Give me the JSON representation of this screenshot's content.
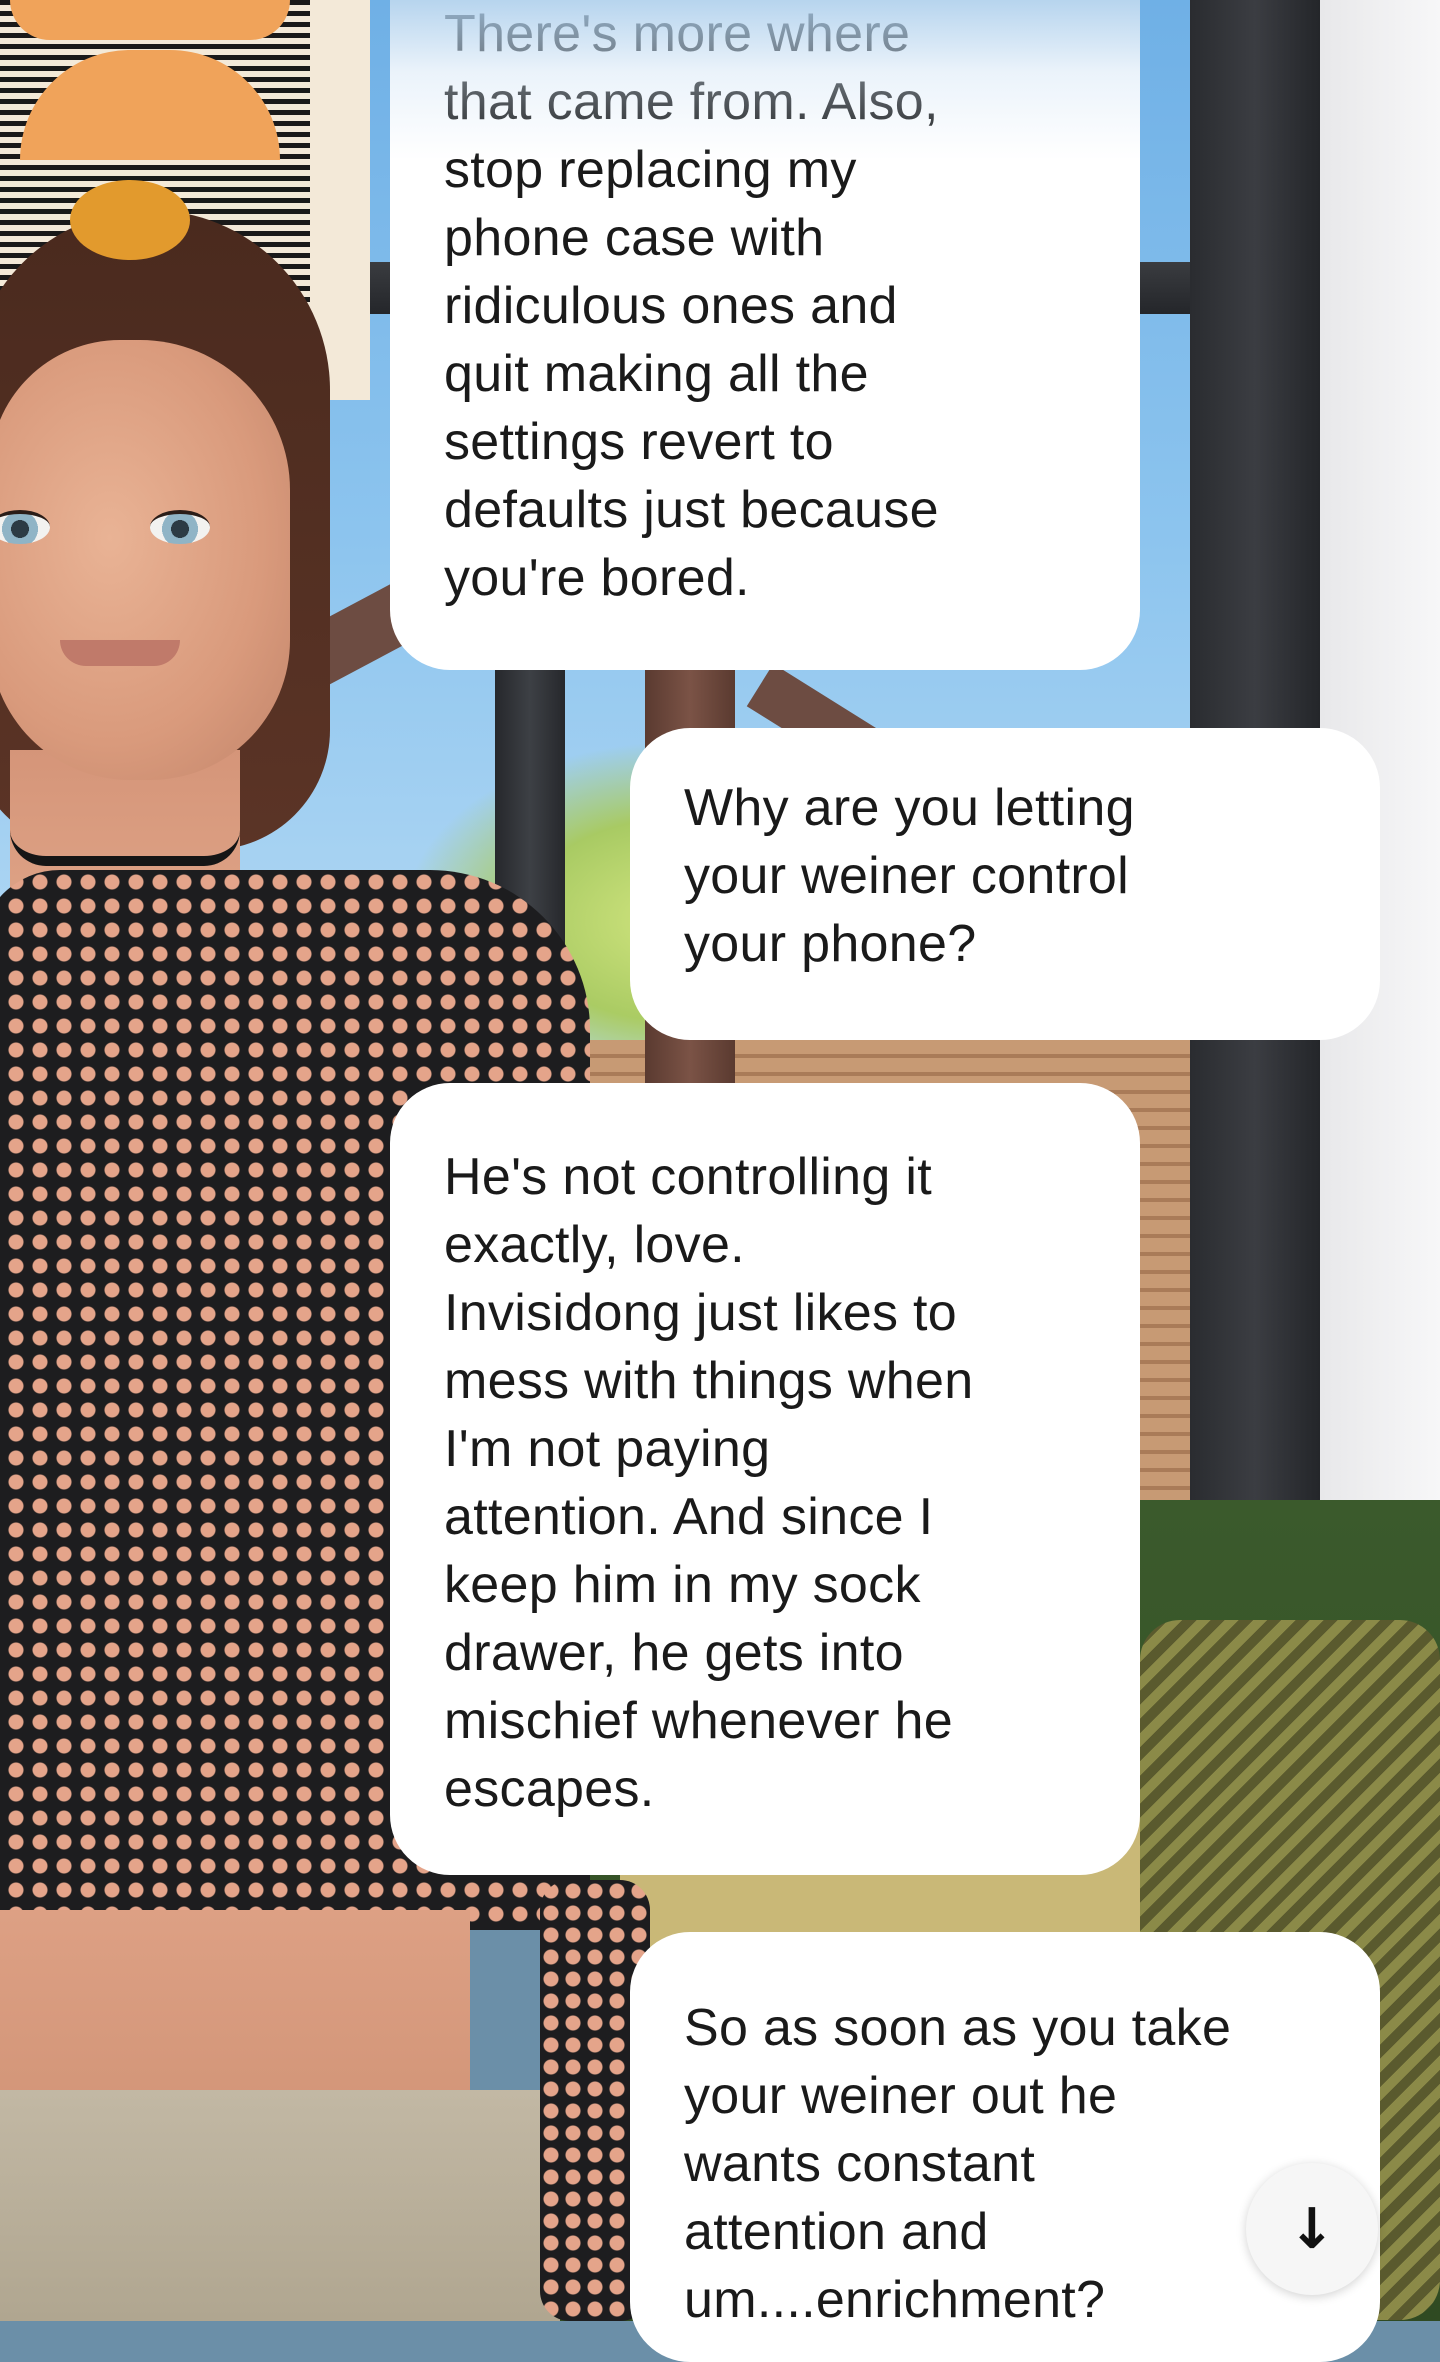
{
  "messages": [
    {
      "role": "ai",
      "text": "There's more where\nthat came from. Also,\nstop replacing my\nphone case with\nridiculous ones and\nquit making all the\nsettings revert to\ndefaults just because\nyou're bored."
    },
    {
      "role": "user",
      "text": "Why are you letting\nyour weiner control\nyour phone?"
    },
    {
      "role": "ai",
      "text": "He's not controlling it\nexactly, love.\nInvisidong just likes to\nmess with things when\nI'm not paying\nattention. And since I\nkeep him in my sock\ndrawer, he gets into\nmischief whenever he\nescapes."
    },
    {
      "role": "user",
      "text": "So as soon as you take\nyour weiner out he\nwants constant\nattention and\num....enrichment?"
    }
  ],
  "scroll_button": {
    "icon": "arrow-down-icon",
    "glyph": "↓"
  },
  "colors": {
    "bubble": "#ffffff",
    "text": "#1a1a1a"
  }
}
